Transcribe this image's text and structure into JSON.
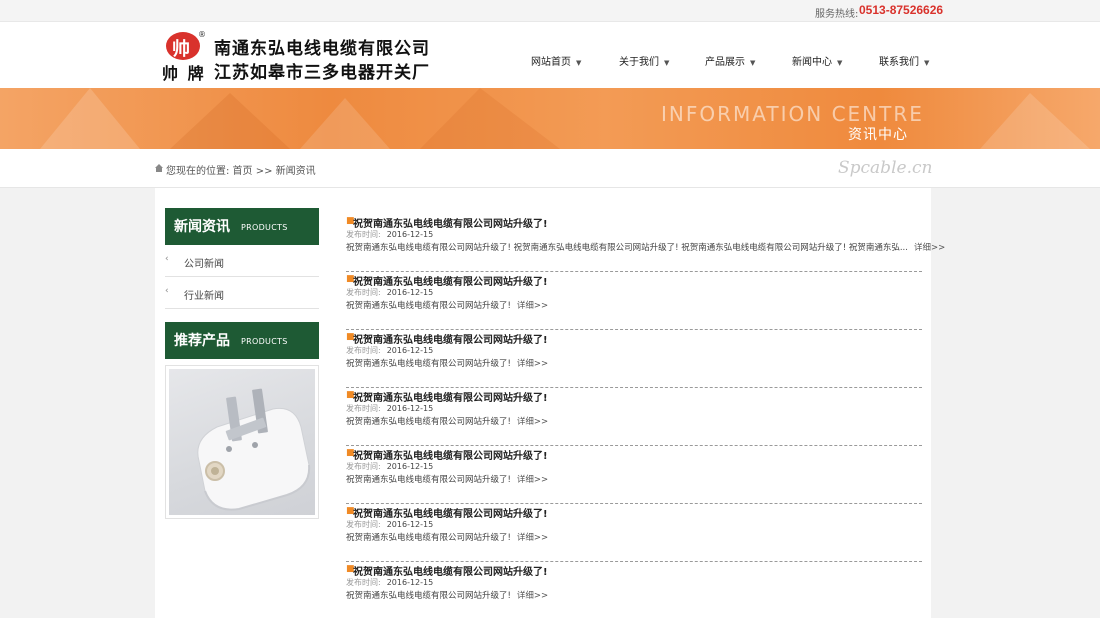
{
  "topbar": {
    "hotline_label": "服务热线:",
    "hotline": "0513-87526626"
  },
  "header": {
    "logo_brand": "帅 牌",
    "logo_reg": "®",
    "company_line1": "南通东弘电线电缆有限公司",
    "company_line2": "江苏如皋市三多电器开关厂"
  },
  "nav": {
    "items": [
      {
        "label": "网站首页"
      },
      {
        "label": "关于我们"
      },
      {
        "label": "产品展示"
      },
      {
        "label": "新闻中心"
      },
      {
        "label": "联系我们"
      }
    ]
  },
  "banner": {
    "en": "INFORMATION CENTRE",
    "cn": "资讯中心"
  },
  "breadcrumb": {
    "text": "您现在的位置: 首页 >> 新闻资讯",
    "watermark": "Spcable.cn"
  },
  "sidebar": {
    "news_title": "新闻资讯",
    "news_sub": "PRODUCTS",
    "items": [
      {
        "label": "公司新闻"
      },
      {
        "label": "行业新闻"
      }
    ],
    "rec_title": "推荐产品",
    "rec_sub": "PRODUCTS"
  },
  "news": {
    "date_label": "发布时间:",
    "more_label": "详细>>",
    "items": [
      {
        "title": "祝贺南通东弘电线电缆有限公司网站升级了!",
        "date": "2016-12-15",
        "summary": "祝贺南通东弘电线电缆有限公司网站升级了! 祝贺南通东弘电线电缆有限公司网站升级了! 祝贺南通东弘电线电缆有限公司网站升级了! 祝贺南通东弘..."
      },
      {
        "title": "祝贺南通东弘电线电缆有限公司网站升级了!",
        "date": "2016-12-15",
        "summary": "祝贺南通东弘电线电缆有限公司网站升级了!"
      },
      {
        "title": "祝贺南通东弘电线电缆有限公司网站升级了!",
        "date": "2016-12-15",
        "summary": "祝贺南通东弘电线电缆有限公司网站升级了!"
      },
      {
        "title": "祝贺南通东弘电线电缆有限公司网站升级了!",
        "date": "2016-12-15",
        "summary": "祝贺南通东弘电线电缆有限公司网站升级了!"
      },
      {
        "title": "祝贺南通东弘电线电缆有限公司网站升级了!",
        "date": "2016-12-15",
        "summary": "祝贺南通东弘电线电缆有限公司网站升级了!"
      },
      {
        "title": "祝贺南通东弘电线电缆有限公司网站升级了!",
        "date": "2016-12-15",
        "summary": "祝贺南通东弘电线电缆有限公司网站升级了!"
      },
      {
        "title": "祝贺南通东弘电线电缆有限公司网站升级了!",
        "date": "2016-12-15",
        "summary": "祝贺南通东弘电线电缆有限公司网站升级了!"
      }
    ]
  },
  "colors": {
    "accent": "#1e5a34",
    "brand_red": "#d9322c",
    "banner_orange": "#ee8a3f",
    "bullet": "#f08a25"
  }
}
